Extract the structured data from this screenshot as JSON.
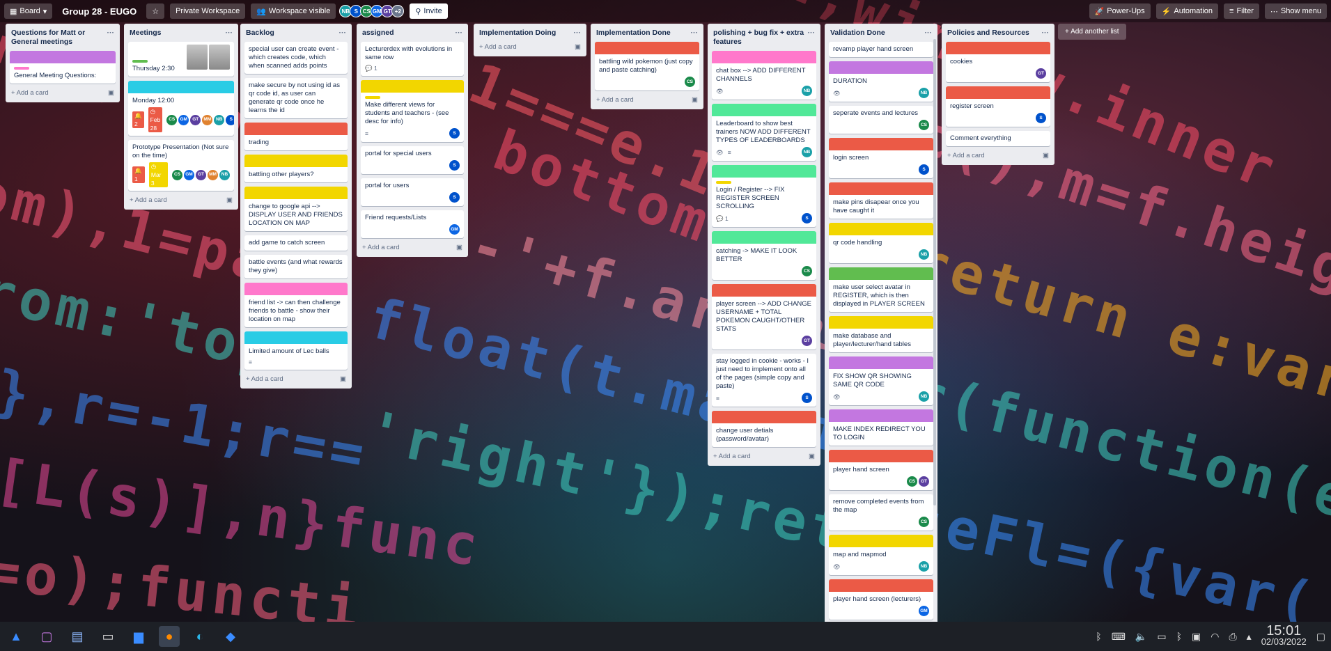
{
  "header": {
    "view_label": "Board",
    "board_title": "Group 28 - EUGO",
    "workspace_label": "Private Workspace",
    "visibility_label": "Workspace visible",
    "members": [
      "NB",
      "S",
      "CS",
      "GM",
      "GT"
    ],
    "members_more": "+2",
    "invite_label": "Invite",
    "powerups_label": "Power-Ups",
    "automation_label": "Automation",
    "filter_label": "Filter",
    "show_menu_label": "Show menu"
  },
  "colors": {
    "purple": "#c377e0",
    "pink": "#ff78cb",
    "sky": "#29cce5",
    "red": "#eb5a46",
    "yellow": "#f2d600",
    "green": "#61bd4f",
    "lime": "#51e898",
    "avatar_CS": "#1a8a4a",
    "avatar_GM": "#0c66e4",
    "avatar_GT": "#5b3fa0",
    "avatar_MM": "#e0822f",
    "avatar_NB": "#1aa0a8",
    "avatar_S": "#0052cc"
  },
  "lists": [
    {
      "title": "Questions for Matt or General meetings",
      "cards": [
        {
          "text": "General Meeting Questions:",
          "cover": "purple",
          "label": "pink"
        }
      ],
      "add_card": "Add a card"
    },
    {
      "title": "Meetings",
      "cards": [
        {
          "text": "Thursday 2:30",
          "label": "green",
          "thumbs": true
        },
        {
          "text": "Monday 12:00",
          "cover": "sky",
          "notif": "2",
          "due": "Feb 28",
          "due_color": "#eb5a46",
          "members": [
            "CS",
            "GM",
            "GT",
            "MM",
            "NB",
            "S"
          ]
        },
        {
          "text": "Prototype Presentation (Not sure on the time)",
          "notif": "1",
          "due": "Mar 3",
          "due_color": "#f2d600",
          "members": [
            "CS",
            "GM",
            "GT",
            "MM",
            "NB"
          ]
        }
      ],
      "add_card": "Add a card"
    },
    {
      "title": "Backlog",
      "cards": [
        {
          "text": "special user can create event - which creates code, which when scanned adds points"
        },
        {
          "text": "make secure by not using id as qr code id, as user can generate qr code once he learns the id"
        },
        {
          "text": "trading",
          "cover": "red"
        },
        {
          "text": "battling other players?",
          "cover": "yellow"
        },
        {
          "text": "change to google api --> DISPLAY USER AND FRIENDS LOCATION ON MAP",
          "cover": "yellow"
        },
        {
          "text": "add game to catch screen"
        },
        {
          "text": "battle events (and what rewards they give)"
        },
        {
          "text": "friend list -> can then challenge friends to battle - show their location on map",
          "cover": "pink"
        },
        {
          "text": "Limited amount of Lec balls",
          "cover": "sky",
          "desc": true
        }
      ],
      "add_card": "Add a card"
    },
    {
      "title": "assigned",
      "cards": [
        {
          "text": "Lecturerdex with evolutions in same row",
          "comments": "1"
        },
        {
          "text": "Make different views for students and teachers - (see desc for info)",
          "cover": "yellow",
          "label": "yellow",
          "desc": true,
          "members": [
            "S"
          ]
        },
        {
          "text": "portal for special users",
          "members": [
            "S"
          ]
        },
        {
          "text": "portal for users",
          "members": [
            "S"
          ]
        },
        {
          "text": "Friend requests/Lists",
          "members": [
            "GM"
          ]
        }
      ],
      "add_card": "Add a card"
    },
    {
      "title": "Implementation Doing",
      "cards": [],
      "add_card": "Add a card"
    },
    {
      "title": "Implementation Done",
      "cards": [
        {
          "text": "battling wild pokemon (just copy and paste catching)",
          "cover": "red",
          "members": [
            "CS"
          ]
        }
      ],
      "add_card": "Add a card"
    },
    {
      "title": "polishing + bug fix + extra features",
      "cards": [
        {
          "text": "chat box --> ADD DIFFERENT CHANNELS",
          "cover": "pink",
          "watch": true,
          "members": [
            "NB"
          ]
        },
        {
          "text": "Leaderboard to show best trainers NOW ADD DIFFERENT TYPES OF LEADERBOARDS",
          "cover": "lime",
          "watch": true,
          "desc": true,
          "members": [
            "NB"
          ]
        },
        {
          "text": "Login / Register --> FIX REGISTER SCREEN SCROLLING",
          "cover": "lime",
          "label": "yellow",
          "comments": "1",
          "members": [
            "S"
          ]
        },
        {
          "text": "catching -> MAKE IT LOOK BETTER",
          "cover": "lime",
          "members": [
            "CS"
          ]
        },
        {
          "text": "player screen --> ADD CHANGE USERNAME + TOTAL POKEMON CAUGHT/OTHER STATS",
          "cover": "red",
          "members": [
            "GT"
          ]
        },
        {
          "text": "stay logged in cookie - works - I just need to implement onto all of the pages (simple copy and paste)",
          "desc": true,
          "members": [
            "S"
          ]
        },
        {
          "text": "change user detials (password/avatar)",
          "cover": "red"
        }
      ],
      "add_card": "Add a card"
    },
    {
      "title": "Validation Done",
      "cards": [
        {
          "text": "revamp player hand screen"
        },
        {
          "text": "DURATION",
          "cover": "purple",
          "watch": true,
          "members": [
            "NB"
          ]
        },
        {
          "text": "seperate events and lectures",
          "members": [
            "CS"
          ]
        },
        {
          "text": "login screen",
          "cover": "red",
          "members": [
            "S"
          ]
        },
        {
          "text": "make pins disapear once you have caught it",
          "cover": "red"
        },
        {
          "text": "qr code handling",
          "cover": "yellow",
          "members": [
            "NB"
          ]
        },
        {
          "text": "make user select avatar in REGISTER, which is then displayed in PLAYER SCREEN",
          "cover": "green"
        },
        {
          "text": "make database and player/lecturer/hand tables",
          "cover": "yellow"
        },
        {
          "text": "FIX SHOW QR SHOWING SAME QR CODE",
          "cover": "purple",
          "watch": true,
          "members": [
            "NB"
          ]
        },
        {
          "text": "MAKE INDEX REDIRECT YOU TO LOGIN",
          "cover": "purple"
        },
        {
          "text": "player hand screen",
          "cover": "red",
          "members": [
            "CS",
            "GT"
          ]
        },
        {
          "text": "remove completed events from the map",
          "members": [
            "CS"
          ]
        },
        {
          "text": "map and mapmod",
          "cover": "yellow",
          "watch": true,
          "members": [
            "NB"
          ]
        },
        {
          "text": "player hand screen (lecturers)",
          "cover": "red",
          "members": [
            "GM"
          ]
        }
      ],
      "add_card": "Add a card"
    },
    {
      "title": "Policies and Resources",
      "cards": [
        {
          "text": "cookies",
          "cover": "red",
          "members": [
            "GT"
          ]
        },
        {
          "text": "register screen",
          "cover": "red",
          "members": [
            "S"
          ]
        },
        {
          "text": "Comment everything"
        }
      ],
      "add_card": "Add a card"
    }
  ],
  "add_another_list": "Add another list",
  "taskbar": {
    "time": "15:01",
    "date": "02/03/2022"
  }
}
